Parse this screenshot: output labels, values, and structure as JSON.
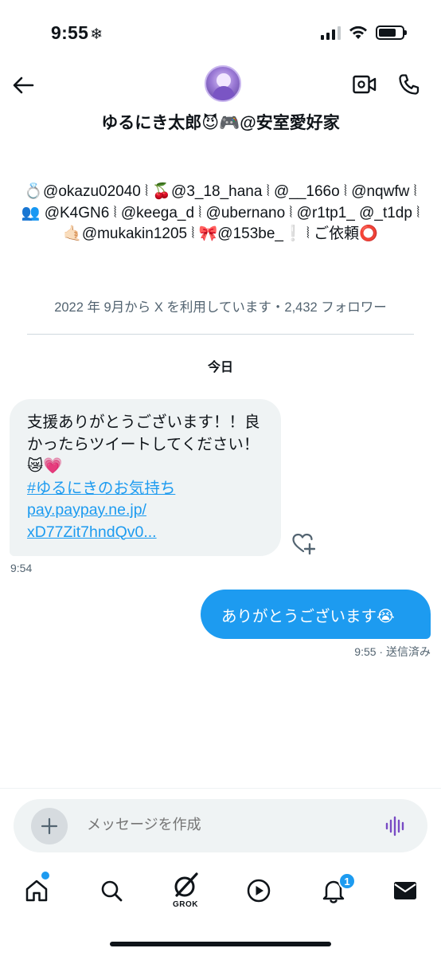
{
  "status_bar": {
    "time": "9:55",
    "time_icon": "snowflake-icon",
    "snow_glyph": "❄"
  },
  "header": {
    "profile_name": "ゆるにき太郎😈🎮@安室愛好家",
    "back_icon": "back-arrow-icon",
    "video_icon": "video-call-icon",
    "phone_icon": "phone-call-icon"
  },
  "bio": {
    "text": "💍@okazu02040 ⦚ 🍒@3_18_hana ⦚ @__166o ⦚ @nqwfw ⦚ 👥 @K4GN6 ⦚ @keega_d ⦚ @ubernano ⦚ @r1tp1_ @_t1dp ⦚ 🤙🏻@mukakin1205 ⦚ 🎀@153be_❕ ⦚ ご依頼⭕",
    "meta": "2022 年 9月から X を利用しています・2,432 フォロワー"
  },
  "conversation": {
    "date_label": "今日",
    "incoming": {
      "text": "支援ありがとうございます！！良かったらツイートしてください！😿💗",
      "hashtag": " #ゆるにきのお気持ち",
      "link_line1": "pay.paypay.ne.jp/",
      "link_line2": "xD77Zit7hndQv0...",
      "time": "9:54"
    },
    "outgoing": {
      "text": "ありがとうございます😭",
      "time": "9:55 · 送信済み"
    }
  },
  "composer": {
    "placeholder": "メッセージを作成"
  },
  "tabbar": {
    "grok_label": "GROK",
    "notification_count": "1"
  },
  "colors": {
    "accent": "#1d9bf0",
    "bubble_in": "#eff3f4",
    "text": "#0f1419",
    "secondary_text": "#536471",
    "voice_icon": "#794bc4"
  }
}
